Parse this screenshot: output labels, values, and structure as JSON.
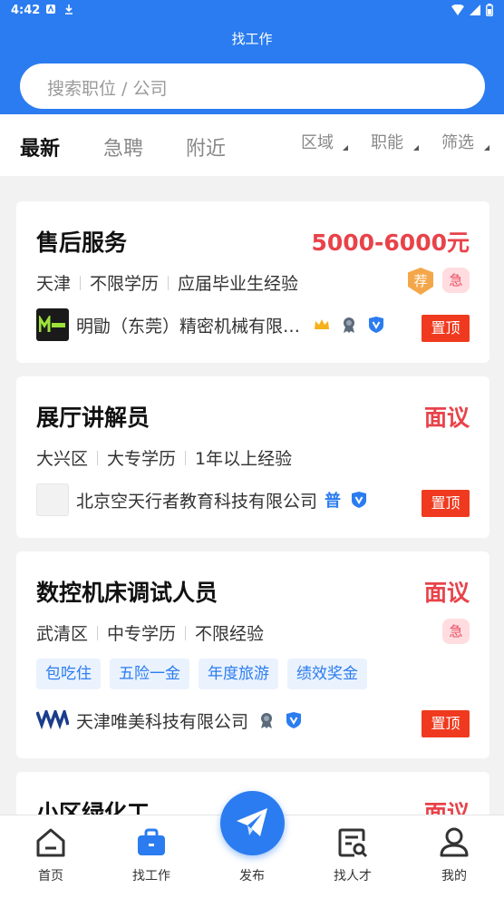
{
  "status_bar": {
    "time": "4:42"
  },
  "header": {
    "title": "找工作",
    "search_placeholder": "搜索职位 / 公司"
  },
  "tabs": [
    {
      "label": "最新",
      "active": true
    },
    {
      "label": "急聘",
      "active": false
    },
    {
      "label": "附近",
      "active": false
    }
  ],
  "filters": [
    {
      "label": "区域"
    },
    {
      "label": "职能"
    },
    {
      "label": "筛选"
    }
  ],
  "jobs": [
    {
      "title": "售后服务",
      "salary": "5000-6000元",
      "reqs": [
        "天津",
        "不限学历",
        "应届毕业生经验"
      ],
      "badges": [
        "荐",
        "急"
      ],
      "company": "明勖（东莞）精密机械有限…",
      "company_icons": [
        "crown-icon",
        "award-icon",
        "verified-icon"
      ],
      "pin_label": "置顶"
    },
    {
      "title": "展厅讲解员",
      "salary": "面议",
      "reqs": [
        "大兴区",
        "大专学历",
        "1年以上经验"
      ],
      "company": "北京空天行者教育科技有限公司",
      "company_badge": "普",
      "company_icons": [
        "verified-icon"
      ],
      "pin_label": "置顶"
    },
    {
      "title": "数控机床调试人员",
      "salary": "面议",
      "reqs": [
        "武清区",
        "中专学历",
        "不限经验"
      ],
      "badges": [
        "急"
      ],
      "tags": [
        "包吃住",
        "五险一金",
        "年度旅游",
        "绩效奖金"
      ],
      "company": "天津唯美科技有限公司",
      "company_icons": [
        "award-icon",
        "verified-icon"
      ],
      "pin_label": "置顶"
    },
    {
      "title": "小区绿化工",
      "salary": "面议"
    }
  ],
  "bottom_nav": [
    {
      "label": "首页",
      "icon": "home-icon",
      "active": false
    },
    {
      "label": "找工作",
      "icon": "briefcase-icon",
      "active": true
    },
    {
      "label": "发布",
      "icon": "send-icon",
      "active": false
    },
    {
      "label": "找人才",
      "icon": "resume-search-icon",
      "active": false
    },
    {
      "label": "我的",
      "icon": "user-icon",
      "active": false
    }
  ],
  "colors": {
    "primary": "#2b7cf0",
    "salary": "#e8434a",
    "pin": "#f03a1f",
    "urgent_bg": "#ffdce0",
    "recommend": "#f4a74a"
  }
}
